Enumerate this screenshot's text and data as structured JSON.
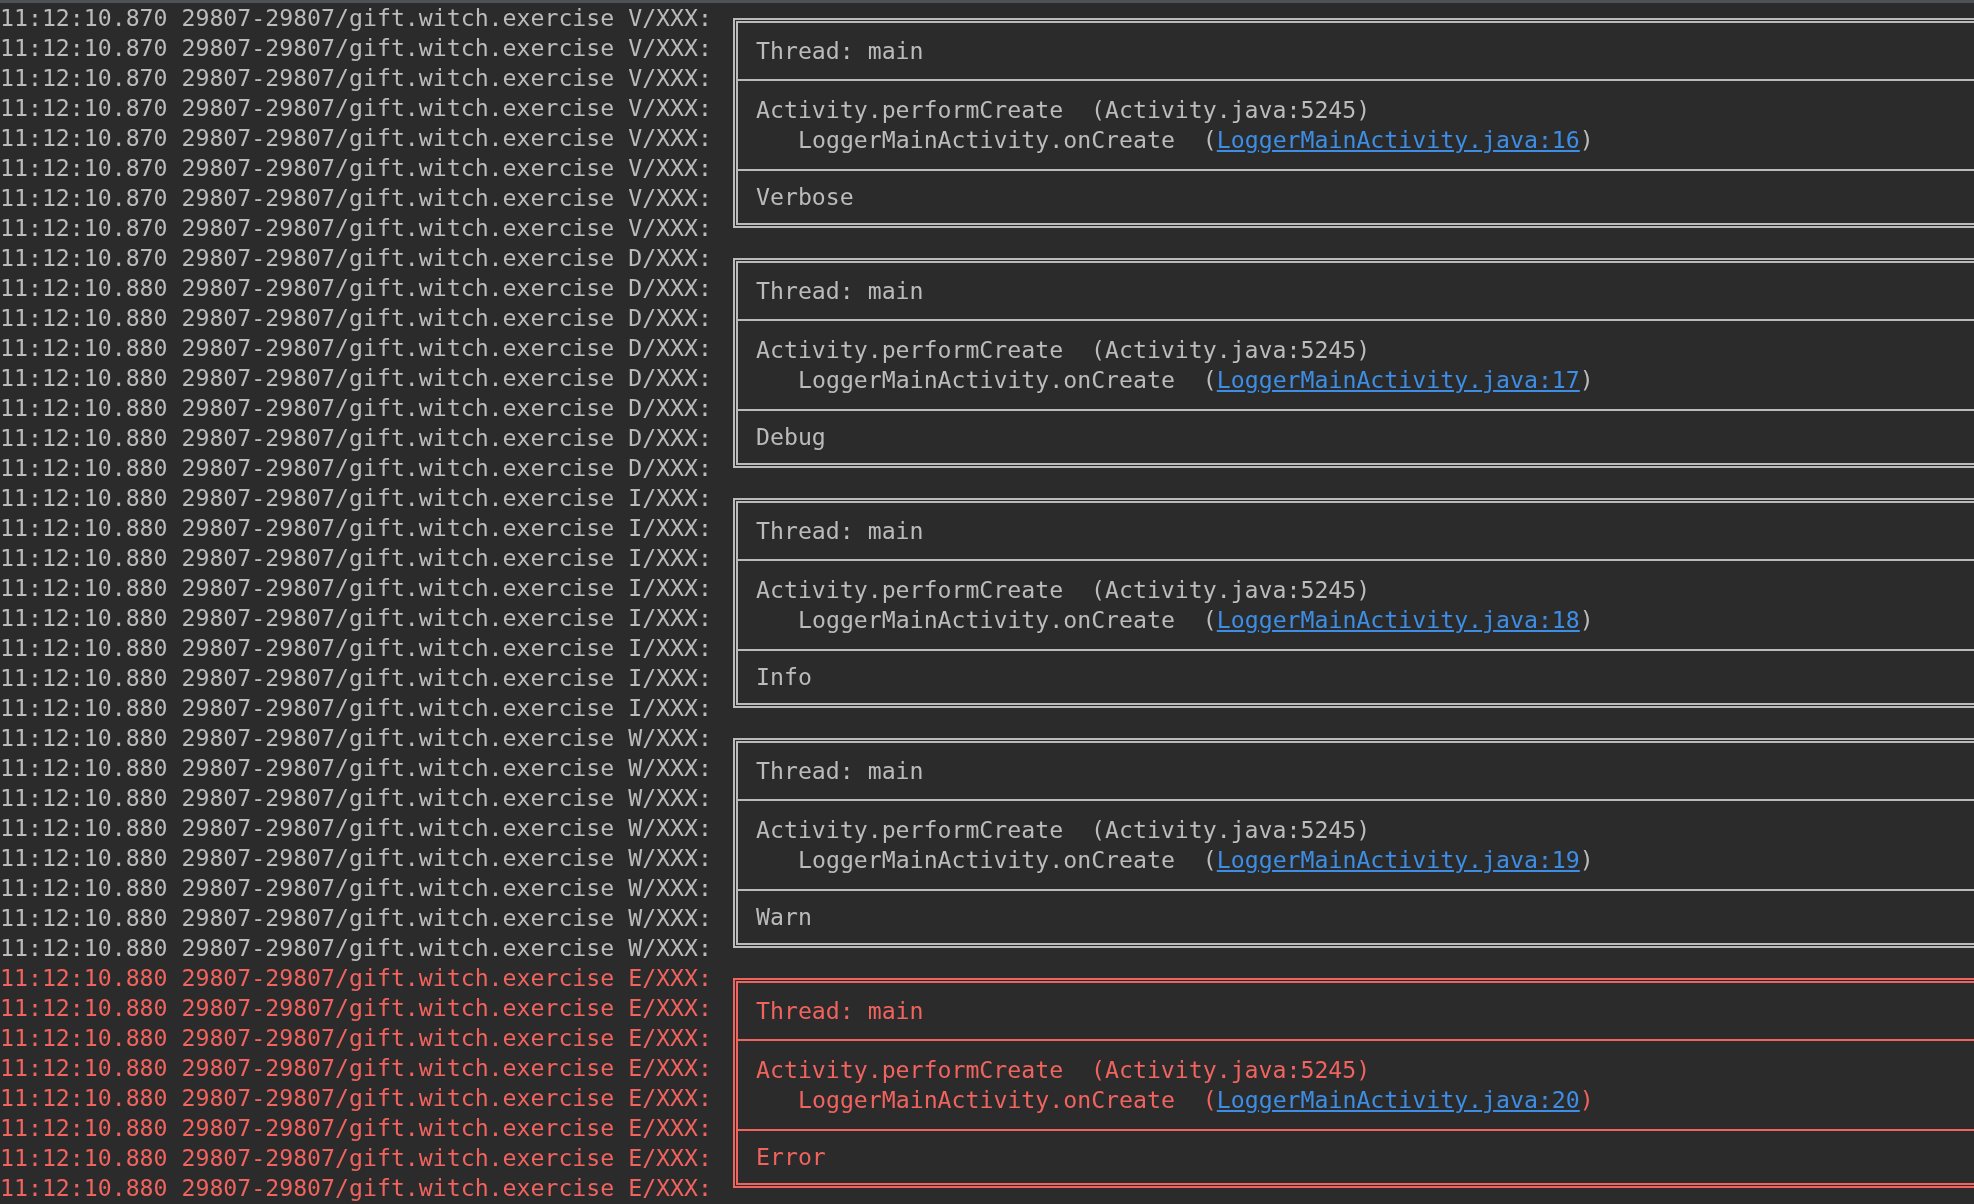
{
  "entries": [
    {
      "kind": "verbose",
      "log_lines": [
        "11:12:10.870 29807-29807/gift.witch.exercise V/XXX:",
        "11:12:10.870 29807-29807/gift.witch.exercise V/XXX:",
        "11:12:10.870 29807-29807/gift.witch.exercise V/XXX:",
        "11:12:10.870 29807-29807/gift.witch.exercise V/XXX:",
        "11:12:10.870 29807-29807/gift.witch.exercise V/XXX:",
        "11:12:10.870 29807-29807/gift.witch.exercise V/XXX:",
        "11:12:10.870 29807-29807/gift.witch.exercise V/XXX:",
        "11:12:10.870 29807-29807/gift.witch.exercise V/XXX:"
      ],
      "thread": "Thread: main",
      "stack": [
        {
          "text": "Activity.performCreate  (Activity.java:5245)"
        },
        {
          "text": "LoggerMainActivity.onCreate  (",
          "link": "LoggerMainActivity.java:16",
          "close": ")"
        }
      ],
      "message": "Verbose"
    },
    {
      "kind": "debug",
      "log_lines": [
        "11:12:10.870 29807-29807/gift.witch.exercise D/XXX:",
        "11:12:10.880 29807-29807/gift.witch.exercise D/XXX:",
        "11:12:10.880 29807-29807/gift.witch.exercise D/XXX:",
        "11:12:10.880 29807-29807/gift.witch.exercise D/XXX:",
        "11:12:10.880 29807-29807/gift.witch.exercise D/XXX:",
        "11:12:10.880 29807-29807/gift.witch.exercise D/XXX:",
        "11:12:10.880 29807-29807/gift.witch.exercise D/XXX:",
        "11:12:10.880 29807-29807/gift.witch.exercise D/XXX:"
      ],
      "thread": "Thread: main",
      "stack": [
        {
          "text": "Activity.performCreate  (Activity.java:5245)"
        },
        {
          "text": "LoggerMainActivity.onCreate  (",
          "link": "LoggerMainActivity.java:17",
          "close": ")"
        }
      ],
      "message": "Debug"
    },
    {
      "kind": "info",
      "log_lines": [
        "11:12:10.880 29807-29807/gift.witch.exercise I/XXX:",
        "11:12:10.880 29807-29807/gift.witch.exercise I/XXX:",
        "11:12:10.880 29807-29807/gift.witch.exercise I/XXX:",
        "11:12:10.880 29807-29807/gift.witch.exercise I/XXX:",
        "11:12:10.880 29807-29807/gift.witch.exercise I/XXX:",
        "11:12:10.880 29807-29807/gift.witch.exercise I/XXX:",
        "11:12:10.880 29807-29807/gift.witch.exercise I/XXX:",
        "11:12:10.880 29807-29807/gift.witch.exercise I/XXX:"
      ],
      "thread": "Thread: main",
      "stack": [
        {
          "text": "Activity.performCreate  (Activity.java:5245)"
        },
        {
          "text": "LoggerMainActivity.onCreate  (",
          "link": "LoggerMainActivity.java:18",
          "close": ")"
        }
      ],
      "message": "Info"
    },
    {
      "kind": "warn",
      "log_lines": [
        "11:12:10.880 29807-29807/gift.witch.exercise W/XXX:",
        "11:12:10.880 29807-29807/gift.witch.exercise W/XXX:",
        "11:12:10.880 29807-29807/gift.witch.exercise W/XXX:",
        "11:12:10.880 29807-29807/gift.witch.exercise W/XXX:",
        "11:12:10.880 29807-29807/gift.witch.exercise W/XXX:",
        "11:12:10.880 29807-29807/gift.witch.exercise W/XXX:",
        "11:12:10.880 29807-29807/gift.witch.exercise W/XXX:",
        "11:12:10.880 29807-29807/gift.witch.exercise W/XXX:"
      ],
      "thread": "Thread: main",
      "stack": [
        {
          "text": "Activity.performCreate  (Activity.java:5245)"
        },
        {
          "text": "LoggerMainActivity.onCreate  (",
          "link": "LoggerMainActivity.java:19",
          "close": ")"
        }
      ],
      "message": "Warn"
    },
    {
      "kind": "error",
      "log_lines": [
        "11:12:10.880 29807-29807/gift.witch.exercise E/XXX:",
        "11:12:10.880 29807-29807/gift.witch.exercise E/XXX:",
        "11:12:10.880 29807-29807/gift.witch.exercise E/XXX:",
        "11:12:10.880 29807-29807/gift.witch.exercise E/XXX:",
        "11:12:10.880 29807-29807/gift.witch.exercise E/XXX:",
        "11:12:10.880 29807-29807/gift.witch.exercise E/XXX:",
        "11:12:10.880 29807-29807/gift.witch.exercise E/XXX:",
        "11:12:10.880 29807-29807/gift.witch.exercise E/XXX:"
      ],
      "thread": "Thread: main",
      "stack": [
        {
          "text": "Activity.performCreate  (Activity.java:5245)"
        },
        {
          "text": "LoggerMainActivity.onCreate  (",
          "link": "LoggerMainActivity.java:20",
          "close": ")"
        }
      ],
      "message": "Error"
    }
  ]
}
